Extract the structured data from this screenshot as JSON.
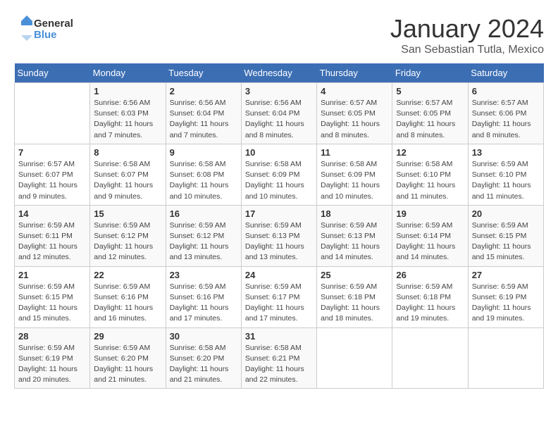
{
  "logo": {
    "general": "General",
    "blue": "Blue"
  },
  "title": "January 2024",
  "subtitle": "San Sebastian Tutla, Mexico",
  "days_of_week": [
    "Sunday",
    "Monday",
    "Tuesday",
    "Wednesday",
    "Thursday",
    "Friday",
    "Saturday"
  ],
  "weeks": [
    [
      {
        "day": "",
        "info": ""
      },
      {
        "day": "1",
        "info": "Sunrise: 6:56 AM\nSunset: 6:03 PM\nDaylight: 11 hours\nand 7 minutes."
      },
      {
        "day": "2",
        "info": "Sunrise: 6:56 AM\nSunset: 6:04 PM\nDaylight: 11 hours\nand 7 minutes."
      },
      {
        "day": "3",
        "info": "Sunrise: 6:56 AM\nSunset: 6:04 PM\nDaylight: 11 hours\nand 8 minutes."
      },
      {
        "day": "4",
        "info": "Sunrise: 6:57 AM\nSunset: 6:05 PM\nDaylight: 11 hours\nand 8 minutes."
      },
      {
        "day": "5",
        "info": "Sunrise: 6:57 AM\nSunset: 6:05 PM\nDaylight: 11 hours\nand 8 minutes."
      },
      {
        "day": "6",
        "info": "Sunrise: 6:57 AM\nSunset: 6:06 PM\nDaylight: 11 hours\nand 8 minutes."
      }
    ],
    [
      {
        "day": "7",
        "info": "Sunrise: 6:57 AM\nSunset: 6:07 PM\nDaylight: 11 hours\nand 9 minutes."
      },
      {
        "day": "8",
        "info": "Sunrise: 6:58 AM\nSunset: 6:07 PM\nDaylight: 11 hours\nand 9 minutes."
      },
      {
        "day": "9",
        "info": "Sunrise: 6:58 AM\nSunset: 6:08 PM\nDaylight: 11 hours\nand 10 minutes."
      },
      {
        "day": "10",
        "info": "Sunrise: 6:58 AM\nSunset: 6:09 PM\nDaylight: 11 hours\nand 10 minutes."
      },
      {
        "day": "11",
        "info": "Sunrise: 6:58 AM\nSunset: 6:09 PM\nDaylight: 11 hours\nand 10 minutes."
      },
      {
        "day": "12",
        "info": "Sunrise: 6:58 AM\nSunset: 6:10 PM\nDaylight: 11 hours\nand 11 minutes."
      },
      {
        "day": "13",
        "info": "Sunrise: 6:59 AM\nSunset: 6:10 PM\nDaylight: 11 hours\nand 11 minutes."
      }
    ],
    [
      {
        "day": "14",
        "info": "Sunrise: 6:59 AM\nSunset: 6:11 PM\nDaylight: 11 hours\nand 12 minutes."
      },
      {
        "day": "15",
        "info": "Sunrise: 6:59 AM\nSunset: 6:12 PM\nDaylight: 11 hours\nand 12 minutes."
      },
      {
        "day": "16",
        "info": "Sunrise: 6:59 AM\nSunset: 6:12 PM\nDaylight: 11 hours\nand 13 minutes."
      },
      {
        "day": "17",
        "info": "Sunrise: 6:59 AM\nSunset: 6:13 PM\nDaylight: 11 hours\nand 13 minutes."
      },
      {
        "day": "18",
        "info": "Sunrise: 6:59 AM\nSunset: 6:13 PM\nDaylight: 11 hours\nand 14 minutes."
      },
      {
        "day": "19",
        "info": "Sunrise: 6:59 AM\nSunset: 6:14 PM\nDaylight: 11 hours\nand 14 minutes."
      },
      {
        "day": "20",
        "info": "Sunrise: 6:59 AM\nSunset: 6:15 PM\nDaylight: 11 hours\nand 15 minutes."
      }
    ],
    [
      {
        "day": "21",
        "info": "Sunrise: 6:59 AM\nSunset: 6:15 PM\nDaylight: 11 hours\nand 15 minutes."
      },
      {
        "day": "22",
        "info": "Sunrise: 6:59 AM\nSunset: 6:16 PM\nDaylight: 11 hours\nand 16 minutes."
      },
      {
        "day": "23",
        "info": "Sunrise: 6:59 AM\nSunset: 6:16 PM\nDaylight: 11 hours\nand 17 minutes."
      },
      {
        "day": "24",
        "info": "Sunrise: 6:59 AM\nSunset: 6:17 PM\nDaylight: 11 hours\nand 17 minutes."
      },
      {
        "day": "25",
        "info": "Sunrise: 6:59 AM\nSunset: 6:18 PM\nDaylight: 11 hours\nand 18 minutes."
      },
      {
        "day": "26",
        "info": "Sunrise: 6:59 AM\nSunset: 6:18 PM\nDaylight: 11 hours\nand 19 minutes."
      },
      {
        "day": "27",
        "info": "Sunrise: 6:59 AM\nSunset: 6:19 PM\nDaylight: 11 hours\nand 19 minutes."
      }
    ],
    [
      {
        "day": "28",
        "info": "Sunrise: 6:59 AM\nSunset: 6:19 PM\nDaylight: 11 hours\nand 20 minutes."
      },
      {
        "day": "29",
        "info": "Sunrise: 6:59 AM\nSunset: 6:20 PM\nDaylight: 11 hours\nand 21 minutes."
      },
      {
        "day": "30",
        "info": "Sunrise: 6:58 AM\nSunset: 6:20 PM\nDaylight: 11 hours\nand 21 minutes."
      },
      {
        "day": "31",
        "info": "Sunrise: 6:58 AM\nSunset: 6:21 PM\nDaylight: 11 hours\nand 22 minutes."
      },
      {
        "day": "",
        "info": ""
      },
      {
        "day": "",
        "info": ""
      },
      {
        "day": "",
        "info": ""
      }
    ]
  ]
}
